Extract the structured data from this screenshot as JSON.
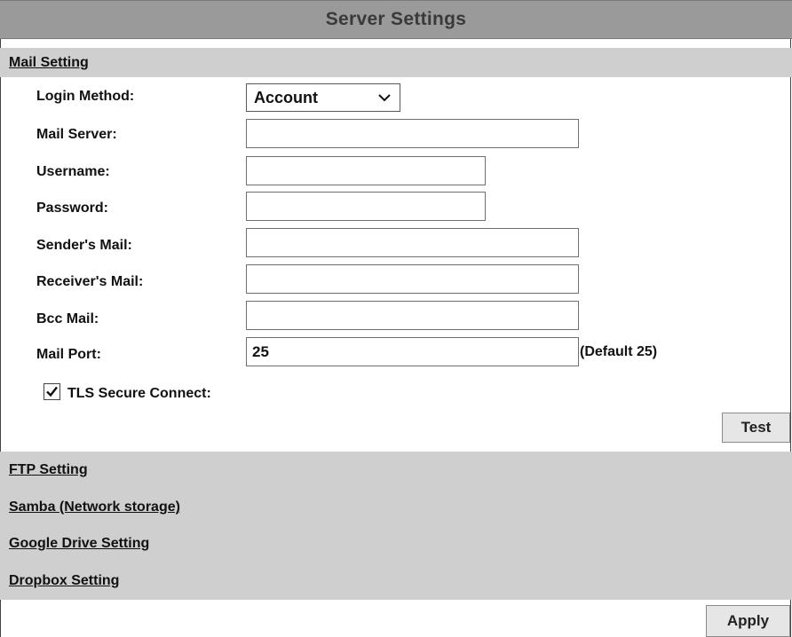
{
  "header": {
    "title": "Server Settings"
  },
  "mail_section": {
    "label": "Mail Setting",
    "login_method": {
      "label": "Login Method:",
      "value": "Account"
    },
    "mail_server": {
      "label": "Mail Server:",
      "value": ""
    },
    "username": {
      "label": "Username:",
      "value": ""
    },
    "password": {
      "label": "Password:",
      "value": ""
    },
    "senders_mail": {
      "label": "Sender's Mail:",
      "value": ""
    },
    "receivers_mail": {
      "label": "Receiver's Mail:",
      "value": ""
    },
    "bcc_mail": {
      "label": "Bcc Mail:",
      "value": ""
    },
    "mail_port": {
      "label": "Mail Port:",
      "value": "25",
      "hint": "(Default 25)"
    },
    "tls": {
      "label": "TLS Secure Connect:",
      "checked": true
    },
    "test_button": "Test"
  },
  "other_sections": {
    "ftp": "FTP Setting",
    "samba": "Samba (Network storage)",
    "google_drive": "Google Drive Setting",
    "dropbox": "Dropbox Setting"
  },
  "apply_button": "Apply",
  "colors": {
    "title_bar": "#9a9a9a",
    "section_bg": "#cfcfcf",
    "button_bg": "#e6e6e6"
  }
}
